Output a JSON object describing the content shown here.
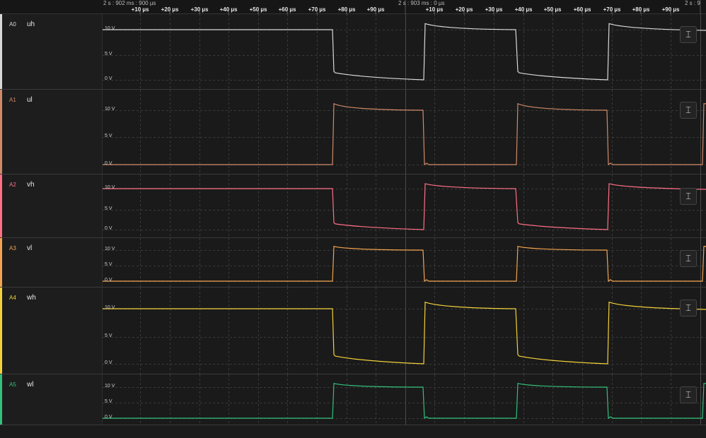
{
  "ruler": {
    "timestamps": [
      "2 s : 902 ms : 900 µs",
      "2 s : 903 ms : 0 µs",
      "2 s : 9"
    ],
    "ticks_a": [
      "+10 µs",
      "+20 µs",
      "+30 µs",
      "+40 µs",
      "+50 µs",
      "+60 µs",
      "+70 µs",
      "+80 µs",
      "+90 µs"
    ],
    "ticks_b": [
      "+10 µs",
      "+20 µs",
      "+30 µs",
      "+40 µs",
      "+50 µs",
      "+60 µs",
      "+70 µs",
      "+80 µs",
      "+90 µs"
    ]
  },
  "y_labels": [
    "10 V",
    "5 V",
    "0 V"
  ],
  "scale_icon": "vertical-scale-icon",
  "scale_glyph": "⌶",
  "channels": [
    {
      "id": "A0",
      "name": "uh",
      "color": "#d8d8d8",
      "phase": "high"
    },
    {
      "id": "A1",
      "name": "ul",
      "color": "#d08a68",
      "phase": "low"
    },
    {
      "id": "A2",
      "name": "vh",
      "color": "#ff6f86",
      "phase": "high"
    },
    {
      "id": "A3",
      "name": "vl",
      "color": "#f3a34f",
      "phase": "low"
    },
    {
      "id": "A4",
      "name": "wh",
      "color": "#f3d13a",
      "phase": "high"
    },
    {
      "id": "A5",
      "name": "wl",
      "color": "#33c07c",
      "phase": "low"
    }
  ]
}
